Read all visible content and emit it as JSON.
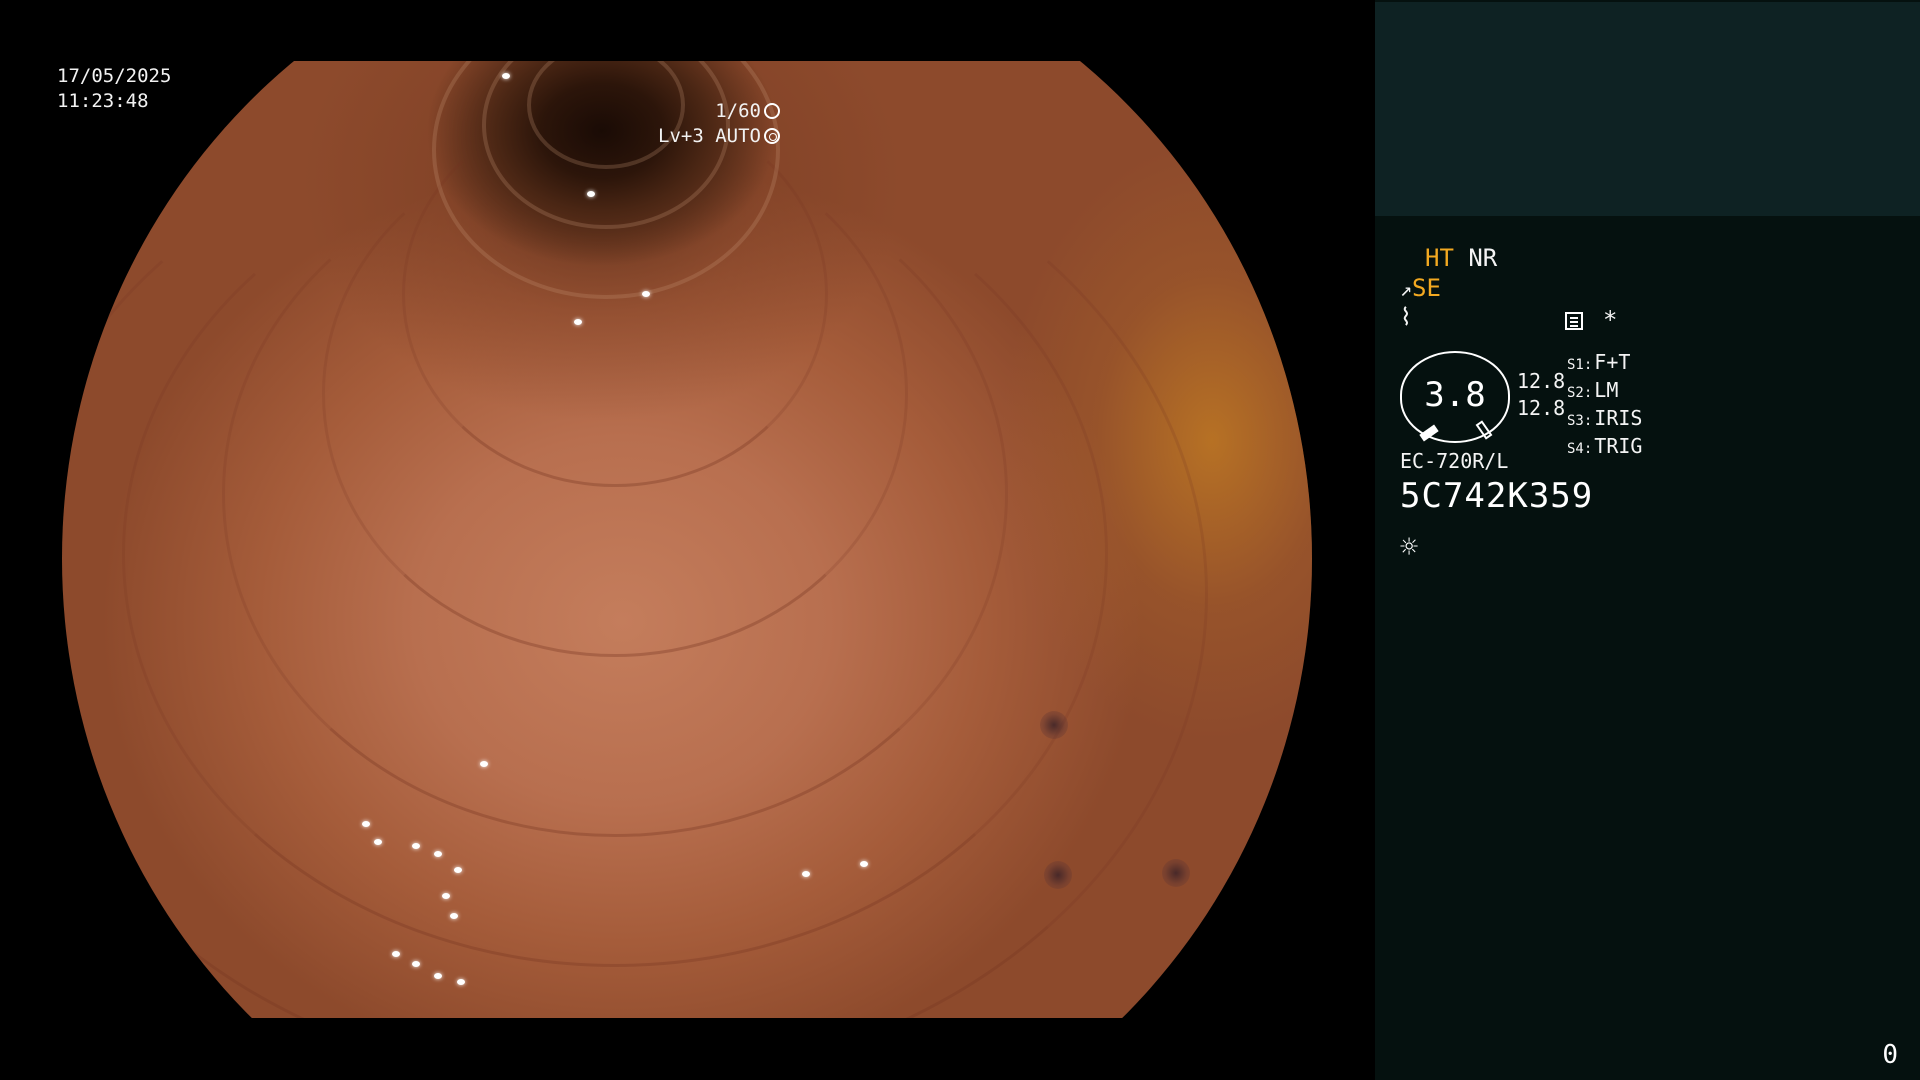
{
  "image": {
    "date": "17/05/2025",
    "time": "11:23:48",
    "shutter_speed": "1/60",
    "shutter_icon": "shutter-icon",
    "brightness": "Lv+3 AUTO",
    "iris_icon": "iris-icon"
  },
  "panel": {
    "colors": {
      "accent": "#f3a921",
      "panel_bg": "#05110f",
      "patient_bg": "#0e2223"
    },
    "mode_ht": "HT",
    "mode_nr": "NR",
    "mode_se_icon": "structure-enhance-icon",
    "mode_se": "SE",
    "filter_icon": "filter-icon",
    "memo_icon": "memo-icon",
    "asterisk": "*",
    "zoom_value": "3.8",
    "side_values": [
      "12.8",
      "12.8"
    ],
    "switches": [
      {
        "key": "S1:",
        "value": "F+T"
      },
      {
        "key": "S2:",
        "value": "LM"
      },
      {
        "key": "S3:",
        "value": "IRIS"
      },
      {
        "key": "S4:",
        "value": "TRIG"
      }
    ],
    "scope_model": "EC-720R/L",
    "serial": "5C742K359",
    "light_icon": "light-source-icon",
    "frame_counter": "0"
  }
}
